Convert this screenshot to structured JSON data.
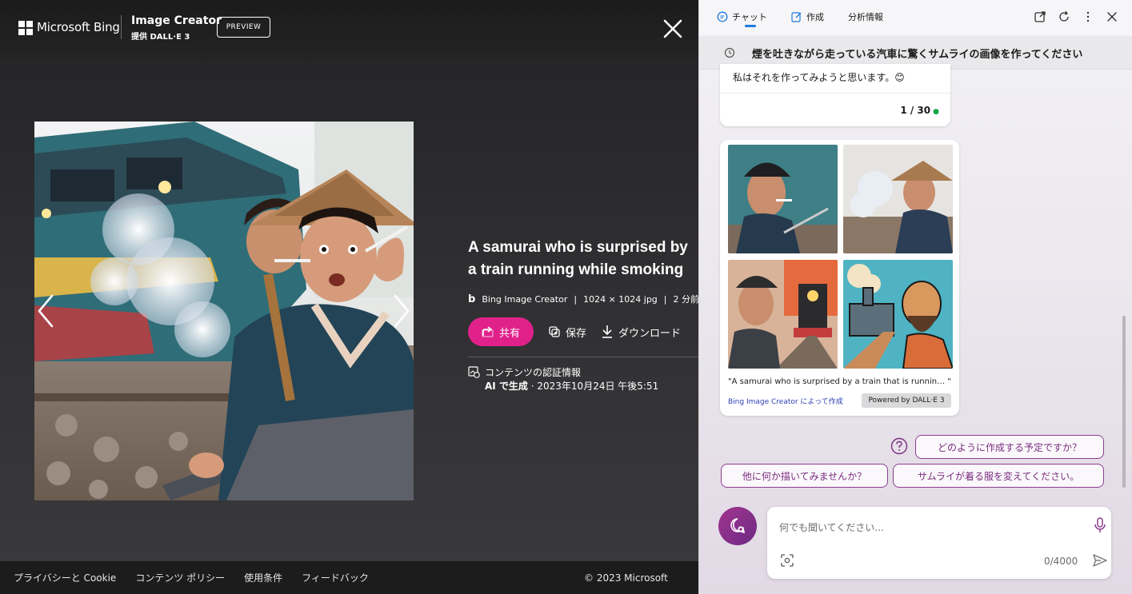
{
  "viewer": {
    "brand": "Microsoft Bing",
    "product_title": "Image Creator",
    "product_subtitle": "提供 DALL·E 3",
    "preview_badge": "PREVIEW",
    "image_title": "A samurai who is surprised by a train running while smoking",
    "meta": {
      "source": "Bing Image Creator",
      "separator": "|",
      "dimensions": "1024 × 1024 jpg",
      "time": "2 分前"
    },
    "actions": {
      "share": "共有",
      "save": "保存",
      "download": "ダウンロード"
    },
    "credentials": {
      "title": "コンテンツの認証情報",
      "generated_by": "AI で生成",
      "date": " · 2023年10月24日 午後5:51"
    },
    "footer": {
      "privacy": "プライバシーと Cookie",
      "content_policy": "コンテンツ ポリシー",
      "terms": "使用条件",
      "feedback": "フィードバック",
      "copyright": "© 2023 Microsoft"
    }
  },
  "sidebar": {
    "tabs": [
      {
        "label": "チャット",
        "icon": "chat-icon",
        "active": true
      },
      {
        "label": "作成",
        "icon": "compose-icon",
        "active": false
      },
      {
        "label": "分析情報",
        "icon": "",
        "active": false
      }
    ],
    "query": "煙を吐きながら走っている汽車に驚くサムライの画像を作ってください",
    "message": {
      "text": "私はそれを作ってみようと思います。😊",
      "count": "1 / 30"
    },
    "gallery": {
      "caption": "\"A samurai who is surprised by a train that is runnin… \"",
      "attribution": "Bing Image Creator によって作成",
      "powered_by": "Powered by DALL·E 3"
    },
    "suggestions": [
      "どのように作成する予定ですか？",
      "他に何か描いてみませんか？",
      "サムライが着る服を変えてください。"
    ],
    "input": {
      "placeholder": "何でも聞いてください...",
      "value": "",
      "char_count": "0/4000"
    },
    "colors": {
      "accent": "#8a3c8e",
      "share_button": "#e0218a",
      "active_tab_underline": "#1f7ae0"
    }
  }
}
